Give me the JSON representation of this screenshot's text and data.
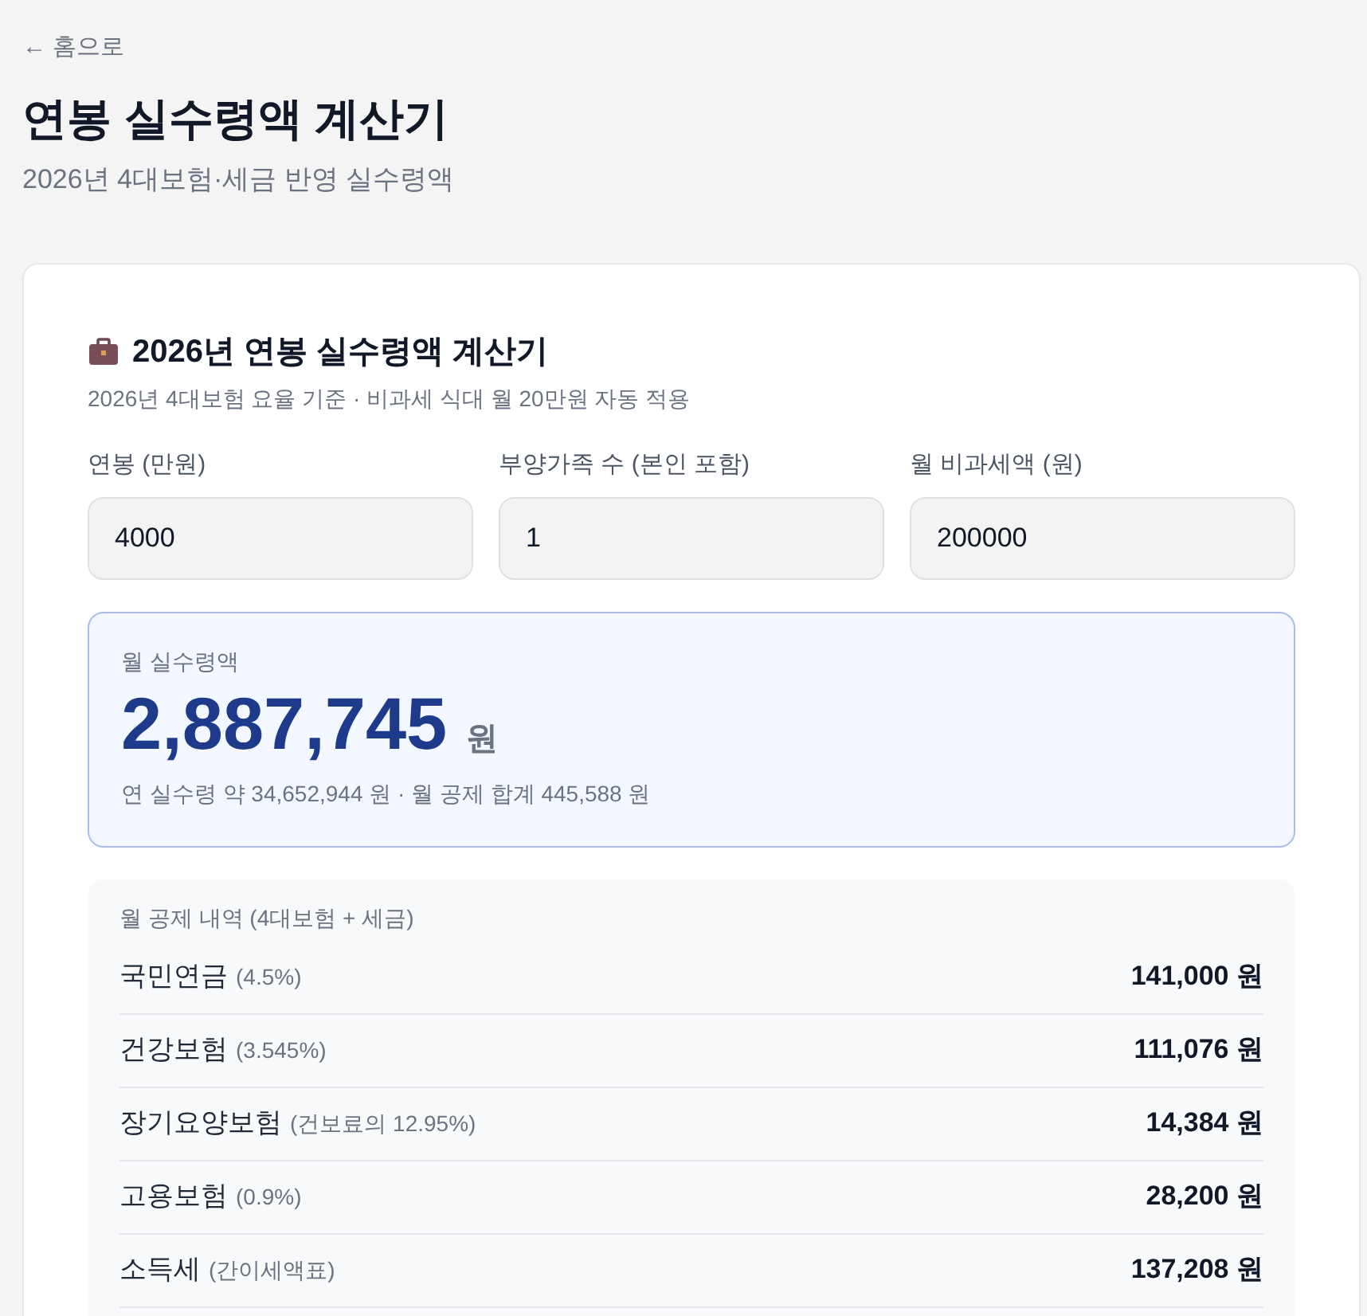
{
  "back_link": "← 홈으로",
  "title": "연봉 실수령액 계산기",
  "subtitle": "2026년 4대보험·세금 반영 실수령액",
  "calculator": {
    "heading": "2026년 연봉 실수령액 계산기",
    "description": "2026년 4대보험 요율 기준 · 비과세 식대 월 20만원 자동 적용",
    "fields": [
      {
        "label": "연봉 (만원)",
        "value": "4000"
      },
      {
        "label": "부양가족 수 (본인 포함)",
        "value": "1"
      },
      {
        "label": "월 비과세액 (원)",
        "value": "200000"
      }
    ],
    "result": {
      "label": "월 실수령액",
      "amount": "2,887,745",
      "unit": "원",
      "summary": "연 실수령 약 34,652,944 원 · 월 공제 합계 445,588 원"
    },
    "deductions": {
      "heading": "월 공제 내역 (4대보험 + 세금)",
      "rows": [
        {
          "label": "국민연금",
          "note": "(4.5%)",
          "amount": "141,000 원"
        },
        {
          "label": "건강보험",
          "note": "(3.545%)",
          "amount": "111,076 원"
        },
        {
          "label": "장기요양보험",
          "note": "(건보료의 12.95%)",
          "amount": "14,384 원"
        },
        {
          "label": "고용보험",
          "note": "(0.9%)",
          "amount": "28,200 원"
        },
        {
          "label": "소득세",
          "note": "(간이세액표)",
          "amount": "137,208 원"
        }
      ]
    }
  }
}
